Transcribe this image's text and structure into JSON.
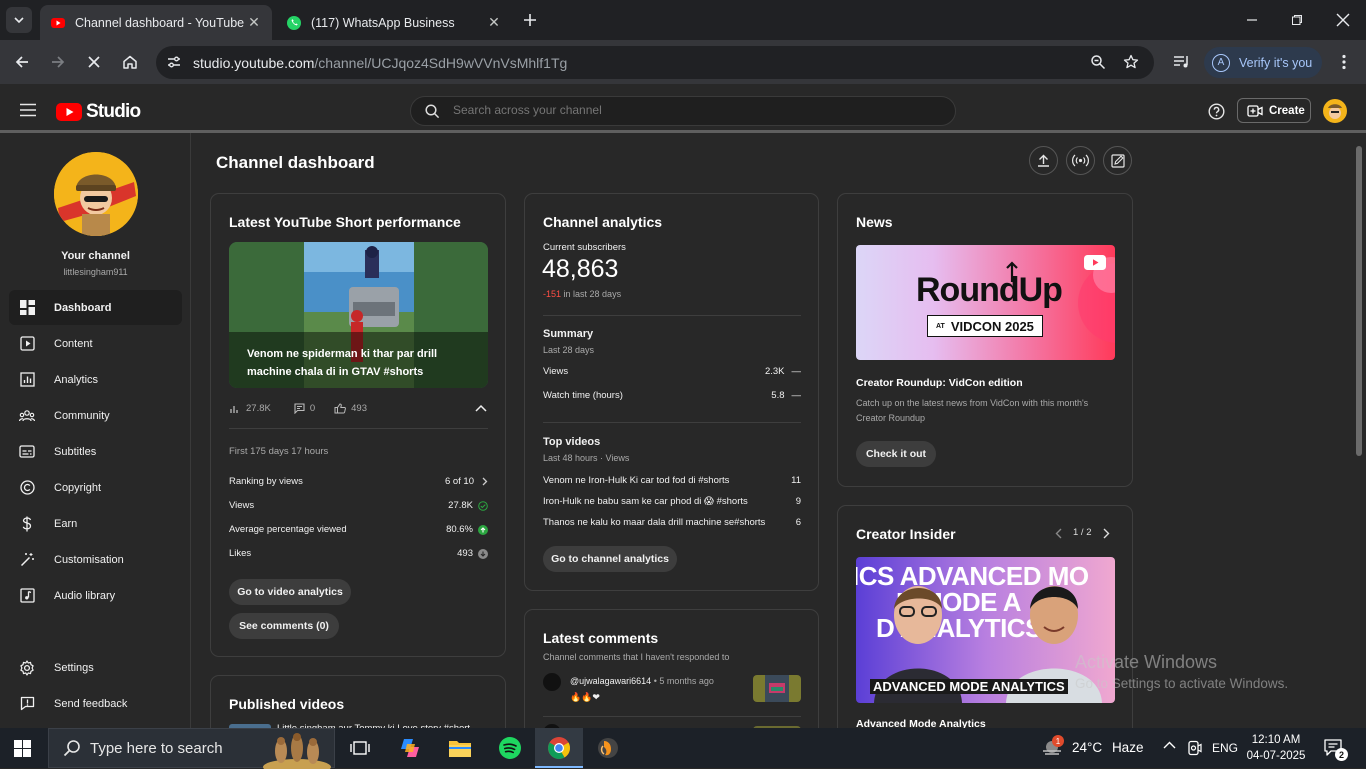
{
  "browser": {
    "tabs": [
      {
        "label": "Channel dashboard - YouTube Studio",
        "active": true
      },
      {
        "label": "(117) WhatsApp Business",
        "active": false
      }
    ],
    "url_host": "studio.youtube.com",
    "url_path": "/channel/UCJqoz4SdH9wVVnVsMhlf1Tg",
    "verify_label": "Verify it's you",
    "verify_avatar": "A"
  },
  "header": {
    "logo_text": "Studio",
    "search_placeholder": "Search across your channel",
    "create_label": "Create"
  },
  "sidebar": {
    "your_channel": "Your channel",
    "handle": "littlesingham911",
    "items": [
      {
        "label": "Dashboard",
        "icon": "dashboard-icon"
      },
      {
        "label": "Content",
        "icon": "content-icon"
      },
      {
        "label": "Analytics",
        "icon": "analytics-icon"
      },
      {
        "label": "Community",
        "icon": "community-icon"
      },
      {
        "label": "Subtitles",
        "icon": "subtitles-icon"
      },
      {
        "label": "Copyright",
        "icon": "copyright-icon"
      },
      {
        "label": "Earn",
        "icon": "earn-icon"
      },
      {
        "label": "Customisation",
        "icon": "customisation-icon"
      },
      {
        "label": "Audio library",
        "icon": "audio-library-icon"
      },
      {
        "label": "Settings",
        "icon": "settings-icon"
      },
      {
        "label": "Send feedback",
        "icon": "feedback-icon"
      }
    ]
  },
  "main": {
    "title": "Channel dashboard",
    "short_card": {
      "title": "Latest YouTube Short performance",
      "video_title": "Venom ne spiderman ki thar par drill machine chala di in GTAV #shorts",
      "views": "27.8K",
      "comments": "0",
      "likes": "493",
      "period": "First 175 days 17 hours",
      "rows": [
        {
          "label": "Ranking by views",
          "value": "6 of 10"
        },
        {
          "label": "Views",
          "value": "27.8K"
        },
        {
          "label": "Average percentage viewed",
          "value": "80.6%"
        },
        {
          "label": "Likes",
          "value": "493"
        }
      ],
      "btn_analytics": "Go to video analytics",
      "btn_comments": "See comments (0)"
    },
    "published_card": {
      "title": "Published videos",
      "first_item": "Little singham aur Tommy ki Love story #short"
    },
    "analytics_card": {
      "title": "Channel analytics",
      "subs_label": "Current subscribers",
      "subs_value": "48,863",
      "subs_delta": "-151",
      "subs_delta_suffix": "in last 28 days",
      "summary_title": "Summary",
      "summary_period": "Last 28 days",
      "summary_rows": [
        {
          "label": "Views",
          "value": "2.3K",
          "trend": "—"
        },
        {
          "label": "Watch time (hours)",
          "value": "5.8",
          "trend": "—"
        }
      ],
      "top_title": "Top videos",
      "top_period": "Last 48 hours · Views",
      "top_videos": [
        {
          "title": "Venom ne Iron-Hulk Ki car tod fod di #shorts",
          "views": "11"
        },
        {
          "title": "Iron-Hulk ne babu sam ke car phod di 😱 #shorts",
          "views": "9"
        },
        {
          "title": "Thanos ne kalu ko maar dala drill machine se#shorts",
          "views": "6"
        }
      ],
      "btn": "Go to channel analytics"
    },
    "comments_card": {
      "title": "Latest comments",
      "subtitle": "Channel comments that I haven't responded to",
      "author": "@ujwalagawari6614",
      "time": "5 months ago",
      "text": "🔥🔥❤"
    },
    "news_card": {
      "title": "News",
      "banner_main": "RoundUp",
      "banner_at": "AT",
      "banner_event": "VIDCON 2025",
      "headline": "Creator Roundup: VidCon edition",
      "body": "Catch up on the latest news from VidCon with this month's Creator Roundup",
      "btn": "Check it out"
    },
    "insider_card": {
      "title": "Creator Insider",
      "page": "1 / 2",
      "thumb_top": "ICS ADVANCED MO",
      "thumb_mid": "D MODE A",
      "thumb_mid2": "D ANALYTICS A",
      "thumb_bottom": "ADVANCED MODE ANALYTICS",
      "caption": "Advanced Mode Analytics"
    }
  },
  "watermark": {
    "line1": "Activate Windows",
    "line2": "Go to Settings to activate Windows."
  },
  "taskbar": {
    "search_placeholder": "Type here to search",
    "weather_temp": "24°C",
    "weather_desc": "Haze",
    "weather_badge": "1",
    "lang": "ENG",
    "time": "12:10 AM",
    "date": "04-07-2025",
    "notif_count": "2"
  },
  "colors": {
    "yt_red": "#ff0000",
    "studio_bg": "#282828",
    "card_border": "#3e3e3e",
    "negative": "#ff4e45",
    "positive": "#2ba640"
  }
}
